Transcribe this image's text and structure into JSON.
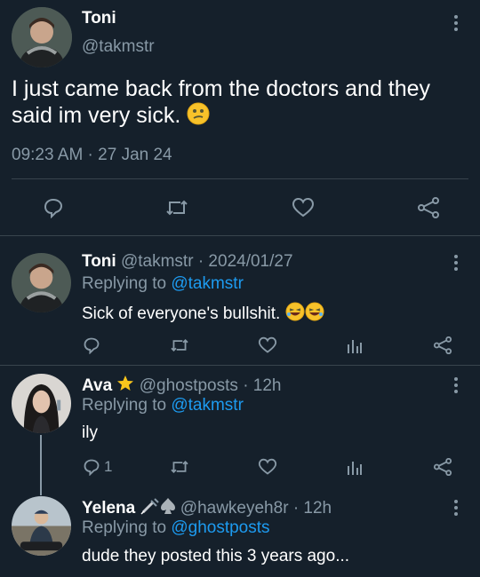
{
  "main_tweet": {
    "name": "Toni",
    "handle": "@takmstr",
    "text": "I just came back from the doctors and they said im very sick.",
    "timestamp": "09:23 AM · 27 Jan 24"
  },
  "replies": [
    {
      "name": "Toni",
      "handle": "@takmstr",
      "time": "· 2024/01/27",
      "replying_prefix": "Replying to",
      "replying_to": "@takmstr",
      "text": "Sick of everyone's bullshit.",
      "reply_count": ""
    },
    {
      "name": "Ava",
      "handle": "@ghostposts",
      "time": "· 12h",
      "replying_prefix": "Replying to",
      "replying_to": "@takmstr",
      "text": "ily",
      "reply_count": "1"
    },
    {
      "name": "Yelena",
      "handle": "@hawkeyeh8r",
      "time": "· 12h",
      "replying_prefix": "Replying to",
      "replying_to": "@ghostposts",
      "text": "dude they posted this 3 years ago..."
    }
  ],
  "icons": [
    "reply-icon",
    "retweet-icon",
    "like-icon",
    "share-icon",
    "analytics-icon",
    "more-icon",
    "star-icon"
  ],
  "colors": {
    "background": "#15202b",
    "text": "#ffffff",
    "muted": "#8899a6",
    "link": "#1d9bf0",
    "divider": "#38444d"
  }
}
